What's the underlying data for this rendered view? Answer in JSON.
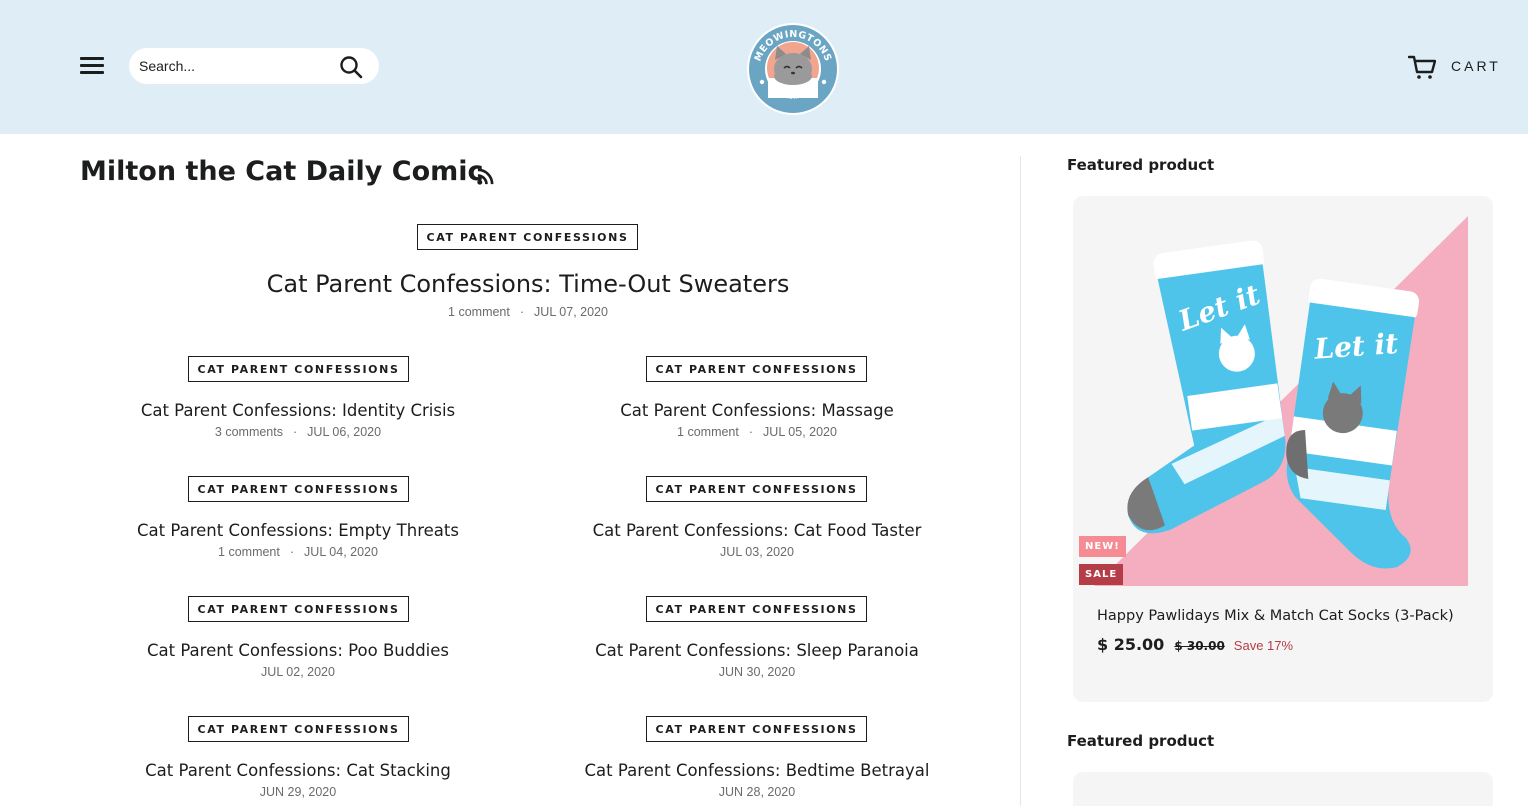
{
  "header": {
    "search_placeholder": "Search...",
    "cart_label": "CART",
    "logo_text": "MEOWINGTONS",
    "logo_subtext": "BY MEOW CLUB",
    "colors": {
      "header_bg": "#dfeef6",
      "logo_ring": "#6aa6c4",
      "logo_inner": "#f2a58e"
    }
  },
  "blog": {
    "title": "Milton the Cat Daily Comic",
    "rss_icon": "rss-icon",
    "featured": {
      "tag": "CAT PARENT CONFESSIONS",
      "title": "Cat Parent Confessions: Time-Out Sweaters",
      "comments": "1 comment",
      "date": "JUL 07, 2020"
    },
    "articles": [
      {
        "tag": "CAT PARENT CONFESSIONS",
        "title": "Cat Parent Confessions: Identity Crisis",
        "comments": "3 comments",
        "date": "JUL 06, 2020"
      },
      {
        "tag": "CAT PARENT CONFESSIONS",
        "title": "Cat Parent Confessions: Massage",
        "comments": "1 comment",
        "date": "JUL 05, 2020"
      },
      {
        "tag": "CAT PARENT CONFESSIONS",
        "title": "Cat Parent Confessions: Empty Threats",
        "comments": "1 comment",
        "date": "JUL 04, 2020"
      },
      {
        "tag": "CAT PARENT CONFESSIONS",
        "title": "Cat Parent Confessions: Cat Food Taster",
        "comments": "",
        "date": "JUL 03, 2020"
      },
      {
        "tag": "CAT PARENT CONFESSIONS",
        "title": "Cat Parent Confessions: Poo Buddies",
        "comments": "",
        "date": "JUL 02, 2020"
      },
      {
        "tag": "CAT PARENT CONFESSIONS",
        "title": "Cat Parent Confessions: Sleep Paranoia",
        "comments": "",
        "date": "JUN 30, 2020"
      },
      {
        "tag": "CAT PARENT CONFESSIONS",
        "title": "Cat Parent Confessions: Cat Stacking",
        "comments": "",
        "date": "JUN 29, 2020"
      },
      {
        "tag": "CAT PARENT CONFESSIONS",
        "title": "Cat Parent Confessions: Bedtime Betrayal",
        "comments": "",
        "date": "JUN 28, 2020"
      }
    ]
  },
  "sidebar": {
    "heading1": "Featured product",
    "heading2": "Featured product",
    "product": {
      "badge_new": "NEW!",
      "badge_sale": "SALE",
      "title": "Happy Pawlidays Mix & Match Cat Socks (3-Pack)",
      "price": "$ 25.00",
      "compare_price": "$ 30.00",
      "save": "Save 17%",
      "sock_text": "Let it Snow",
      "colors": {
        "sale": "#b53d48",
        "new": "#f58b93",
        "pink_bg": "#f5aec0",
        "sock_blue": "#4ec4ea"
      }
    }
  }
}
